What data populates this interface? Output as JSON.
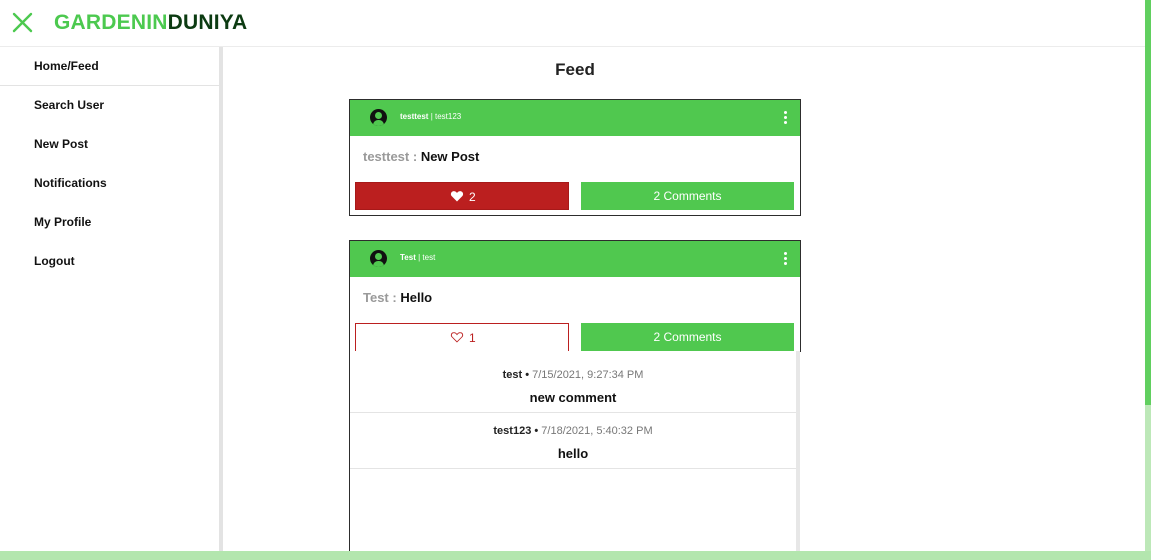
{
  "app": {
    "brand_part1": "GARDENIN",
    "brand_part2": "DUNIYA",
    "colors": {
      "brand_green": "#4cc94f",
      "brand_dark": "#0c3b12",
      "like_red": "#bb1f1f",
      "header_green": "#50c84f"
    }
  },
  "sidebar": {
    "items": [
      {
        "label": "Home/Feed"
      },
      {
        "label": "Search User"
      },
      {
        "label": "New Post"
      },
      {
        "label": "Notifications"
      },
      {
        "label": "My Profile"
      },
      {
        "label": "Logout"
      }
    ]
  },
  "main": {
    "title": "Feed",
    "posts": [
      {
        "name": "testtest",
        "separator": "|",
        "username": "test123",
        "author_label": "testtest :",
        "text": "New Post",
        "likes": "2",
        "liked": true,
        "comments_label": "2 Comments"
      },
      {
        "name": "Test",
        "separator": "|",
        "username": "test",
        "author_label": "Test :",
        "text": "Hello",
        "likes": "1",
        "liked": false,
        "comments_label": "2 Comments",
        "comments": [
          {
            "user": "test",
            "dot": "•",
            "time": "7/15/2021, 9:27:34 PM",
            "text": "new comment"
          },
          {
            "user": "test123",
            "dot": "•",
            "time": "7/18/2021, 5:40:32 PM",
            "text": "hello"
          }
        ]
      }
    ]
  },
  "icons": {
    "close": "close-icon",
    "avatar": "user-avatar-icon",
    "kebab": "more-vertical-icon",
    "heart_filled": "heart-filled-icon",
    "heart_outline": "heart-outline-icon"
  }
}
